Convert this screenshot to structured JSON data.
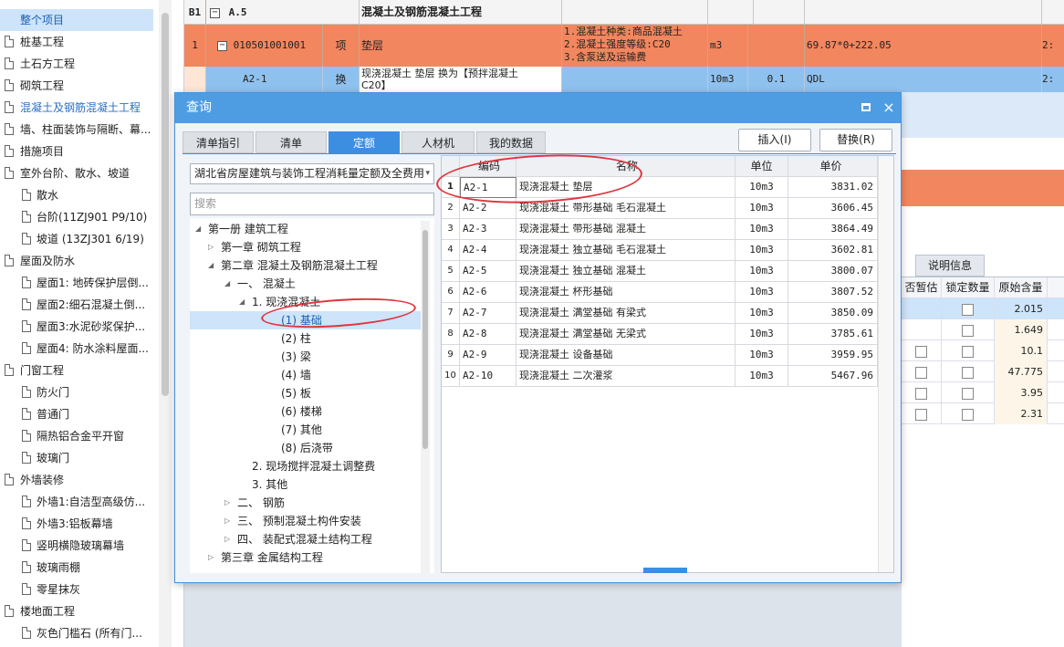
{
  "left_tree": {
    "items": [
      {
        "label": "整个项目",
        "level": 0,
        "selected": true
      },
      {
        "label": "桩基工程",
        "level": 0
      },
      {
        "label": "土石方工程",
        "level": 0
      },
      {
        "label": "砌筑工程",
        "level": 0
      },
      {
        "label": "混凝土及钢筋混凝土工程",
        "level": 0,
        "highlight": true
      },
      {
        "label": "墙、柱面装饰与隔断、幕...",
        "level": 0
      },
      {
        "label": "措施项目",
        "level": 0
      },
      {
        "label": "室外台阶、散水、坡道",
        "level": 0
      },
      {
        "label": "散水",
        "level": 1
      },
      {
        "label": "台阶(11ZJ901 P9/10)",
        "level": 1
      },
      {
        "label": "坡道 (13ZJ301 6/19)",
        "level": 1
      },
      {
        "label": "屋面及防水",
        "level": 0
      },
      {
        "label": "屋面1: 地砖保护层倒...",
        "level": 1
      },
      {
        "label": "屋面2:细石混凝土倒...",
        "level": 1
      },
      {
        "label": "屋面3:水泥砂浆保护...",
        "level": 1
      },
      {
        "label": "屋面4: 防水涂料屋面...",
        "level": 1
      },
      {
        "label": "门窗工程",
        "level": 0
      },
      {
        "label": "防火门",
        "level": 1
      },
      {
        "label": "普通门",
        "level": 1
      },
      {
        "label": "隔热铝合金平开窗",
        "level": 1
      },
      {
        "label": "玻璃门",
        "level": 1
      },
      {
        "label": "外墙装修",
        "level": 0
      },
      {
        "label": "外墙1:自洁型高级仿...",
        "level": 1
      },
      {
        "label": "外墙3:铝板幕墙",
        "level": 1
      },
      {
        "label": "竖明横隐玻璃幕墙",
        "level": 1
      },
      {
        "label": "玻璃雨棚",
        "level": 1
      },
      {
        "label": "零星抹灰",
        "level": 1
      },
      {
        "label": "楼地面工程",
        "level": 0
      },
      {
        "label": "灰色门槛石 (所有门...",
        "level": 1
      }
    ]
  },
  "main_grid": {
    "section_row": {
      "seq": "B1",
      "toggle": "−",
      "code": "A.5",
      "name": "混凝土及钢筋混凝土工程"
    },
    "item_row": {
      "seq": "1",
      "toggle": "−",
      "code": "010501001001",
      "type": "项",
      "name": "垫层",
      "features": [
        "1.混凝土种类:商品混凝土",
        "2.混凝土强度等级:C20",
        "3.含泵送及运输费"
      ],
      "unit": "m3",
      "formula": "69.87*0+222.05",
      "edge": "2:"
    },
    "sub_row": {
      "code": "A2-1",
      "type": "换",
      "name_lines": [
        "现浇混凝土 垫层  换为【预拌混凝土",
        "C20】"
      ],
      "unit": "10m3",
      "qty": "0.1",
      "formula": "QDL",
      "edge": "2:"
    }
  },
  "right_panel": {
    "tab_label": "说明信息",
    "headers": [
      "否暂估",
      "锁定数量",
      "原始含量"
    ],
    "rows": [
      {
        "temp": false,
        "lock": true,
        "orig": "2.015"
      },
      {
        "temp": false,
        "lock": true,
        "orig": "1.649"
      },
      {
        "temp": true,
        "lock": true,
        "orig": "10.1"
      },
      {
        "temp": true,
        "lock": true,
        "orig": "47.775"
      },
      {
        "temp": true,
        "lock": true,
        "orig": "3.95"
      },
      {
        "temp": true,
        "lock": true,
        "orig": "2.31"
      }
    ]
  },
  "dialog": {
    "title": "查询",
    "max_icon": "maximize-icon",
    "close_icon": "×",
    "tabs": [
      "清单指引",
      "清单",
      "定额",
      "人材机",
      "我的数据"
    ],
    "active_tab": 2,
    "buttons": {
      "insert": "插入(I)",
      "replace": "替换(R)"
    },
    "library_select": "湖北省房屋建筑与装饰工程消耗量定额及全费用",
    "library_arrow": "▾",
    "search_placeholder": "搜索",
    "tree": [
      {
        "label": "第一册 建筑工程",
        "arrow": "◢"
      },
      {
        "label": "第一章 砌筑工程",
        "arrow": "▷"
      },
      {
        "label": "第二章 混凝土及钢筋混凝土工程",
        "arrow": "◢"
      },
      {
        "label": "一、 混凝土",
        "arrow": "◢"
      },
      {
        "label": "1. 现浇混凝土",
        "arrow": "◢"
      },
      {
        "label": "(1) 基础",
        "arrow": "",
        "selected": true
      },
      {
        "label": "(2) 柱",
        "arrow": ""
      },
      {
        "label": "(3) 梁",
        "arrow": ""
      },
      {
        "label": "(4) 墙",
        "arrow": ""
      },
      {
        "label": "(5) 板",
        "arrow": ""
      },
      {
        "label": "(6) 楼梯",
        "arrow": ""
      },
      {
        "label": "(7) 其他",
        "arrow": ""
      },
      {
        "label": "(8) 后浇带",
        "arrow": ""
      },
      {
        "label": "2. 现场搅拌混凝土调整费",
        "arrow": ""
      },
      {
        "label": "3. 其他",
        "arrow": ""
      },
      {
        "label": "二、 钢筋",
        "arrow": "▷"
      },
      {
        "label": "三、 预制混凝土构件安装",
        "arrow": "▷"
      },
      {
        "label": "四、 装配式混凝土结构工程",
        "arrow": "▷"
      },
      {
        "label": "第三章 金属结构工程",
        "arrow": "▷"
      }
    ],
    "table": {
      "headers": {
        "code": "编码",
        "name": "名称",
        "unit": "单位",
        "price": "单价"
      },
      "rows": [
        {
          "no": "1",
          "code": "A2-1",
          "name": "现浇混凝土 垫层",
          "unit": "10m3",
          "price": "3831.02"
        },
        {
          "no": "2",
          "code": "A2-2",
          "name": "现浇混凝土 带形基础 毛石混凝土",
          "unit": "10m3",
          "price": "3606.45"
        },
        {
          "no": "3",
          "code": "A2-3",
          "name": "现浇混凝土 带形基础 混凝土",
          "unit": "10m3",
          "price": "3864.49"
        },
        {
          "no": "4",
          "code": "A2-4",
          "name": "现浇混凝土 独立基础 毛石混凝土",
          "unit": "10m3",
          "price": "3602.81"
        },
        {
          "no": "5",
          "code": "A2-5",
          "name": "现浇混凝土 独立基础 混凝土",
          "unit": "10m3",
          "price": "3800.07"
        },
        {
          "no": "6",
          "code": "A2-6",
          "name": "现浇混凝土 杯形基础",
          "unit": "10m3",
          "price": "3807.52"
        },
        {
          "no": "7",
          "code": "A2-7",
          "name": "现浇混凝土 满堂基础 有梁式",
          "unit": "10m3",
          "price": "3850.09"
        },
        {
          "no": "8",
          "code": "A2-8",
          "name": "现浇混凝土 满堂基础 无梁式",
          "unit": "10m3",
          "price": "3785.61"
        },
        {
          "no": "9",
          "code": "A2-9",
          "name": "现浇混凝土 设备基础",
          "unit": "10m3",
          "price": "3959.95"
        },
        {
          "no": "10",
          "code": "A2-10",
          "name": "现浇混凝土 二次灌浆",
          "unit": "10m3",
          "price": "5467.96"
        }
      ]
    }
  },
  "colors": {
    "accent": "#3c8fe0",
    "title_bar": "#4e9de3",
    "orange_row": "#f2865e",
    "annotation": "#e0343d"
  }
}
